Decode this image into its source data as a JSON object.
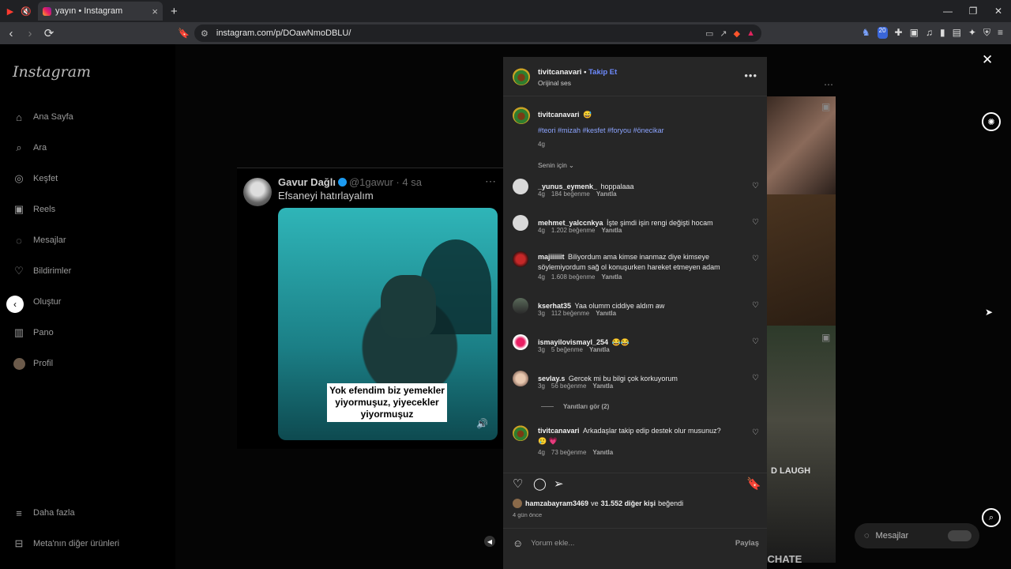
{
  "browser": {
    "tab_title": "yayın • Instagram",
    "url": "instagram.com/p/DOawNmoDBLU/",
    "new_tab": "+",
    "ext_badge": "20"
  },
  "ig": {
    "logo": "Instagram",
    "nav": [
      {
        "label": "Ana Sayfa"
      },
      {
        "label": "Ara"
      },
      {
        "label": "Keşfet"
      },
      {
        "label": "Reels"
      },
      {
        "label": "Mesajlar"
      },
      {
        "label": "Bildirimler"
      },
      {
        "label": "Oluştur"
      },
      {
        "label": "Pano"
      },
      {
        "label": "Profil"
      }
    ],
    "more": "Daha fazla",
    "meta_products": "Meta'nın diğer ürünleri"
  },
  "tweet": {
    "name": "Gavur Dağlı",
    "handle": "@1gawur · 4 sa",
    "text": "Efsaneyi hatırlayalım",
    "subtitle_1": "Yok efendim biz yemekler",
    "subtitle_2": "yiyormuşuz, yiyecekler",
    "subtitle_3": "yiyormuşuz"
  },
  "bg": {
    "overlay_text_1": "D LAUGH",
    "overlay_text_2": "OYUNDA CHATE",
    "messages_pill": "Mesajlar"
  },
  "post": {
    "username": "tivitcanavari",
    "follow": "Takip Et",
    "audio": "Orijinal ses",
    "caption_user": "tivitcanavari",
    "caption_emoji": "😅",
    "hashtags": "#teori #mizah #kesfet #foryou #önecikar",
    "caption_time": "4g",
    "sort_label": "Senin için",
    "comments": [
      {
        "user": "_yunus_eymenk_",
        "text": "hoppalaaa",
        "time": "4g",
        "likes": "184 beğenme",
        "reply": "Yanıtla"
      },
      {
        "user": "mehmet_yalccnkya",
        "text": "İşte şimdi işin rengi değişti hocam",
        "time": "4g",
        "likes": "1.202 beğenme",
        "reply": "Yanıtla"
      },
      {
        "user": "majiiiiiit",
        "text": "Biliyordum ama kimse inanmaz diye kimseye söylemiyordum sağ ol konuşurken hareket etmeyen adam",
        "time": "4g",
        "likes": "1.608 beğenme",
        "reply": "Yanıtla"
      },
      {
        "user": "kserhat35",
        "text": "Yaa olumm ciddiye aldım aw",
        "time": "3g",
        "likes": "112 beğenme",
        "reply": "Yanıtla"
      },
      {
        "user": "ismayilovismayl_254",
        "text": "😂😂",
        "time": "3g",
        "likes": "5 beğenme",
        "reply": "Yanıtla"
      },
      {
        "user": "sevlay.s",
        "text": "Gercek mi bu bilgi çok korkuyorum",
        "time": "3g",
        "likes": "56 beğenme",
        "reply": "Yanıtla"
      },
      {
        "user": "tivitcanavari",
        "text": "Arkadaşlar takip edip destek olur musunuz? 🥲 💗",
        "time": "4g",
        "likes": "73 beğenme",
        "reply": "Yanıtla"
      }
    ],
    "view_replies": "Yanıtları gör (2)",
    "liked_by_user": "hamzabayram3469",
    "liked_by_and": "ve",
    "liked_by_others": "31.552 diğer kişi",
    "liked_suffix": "beğendi",
    "posted_ago": "4 gün önce",
    "comment_placeholder": "Yorum ekle...",
    "share_button": "Paylaş"
  }
}
